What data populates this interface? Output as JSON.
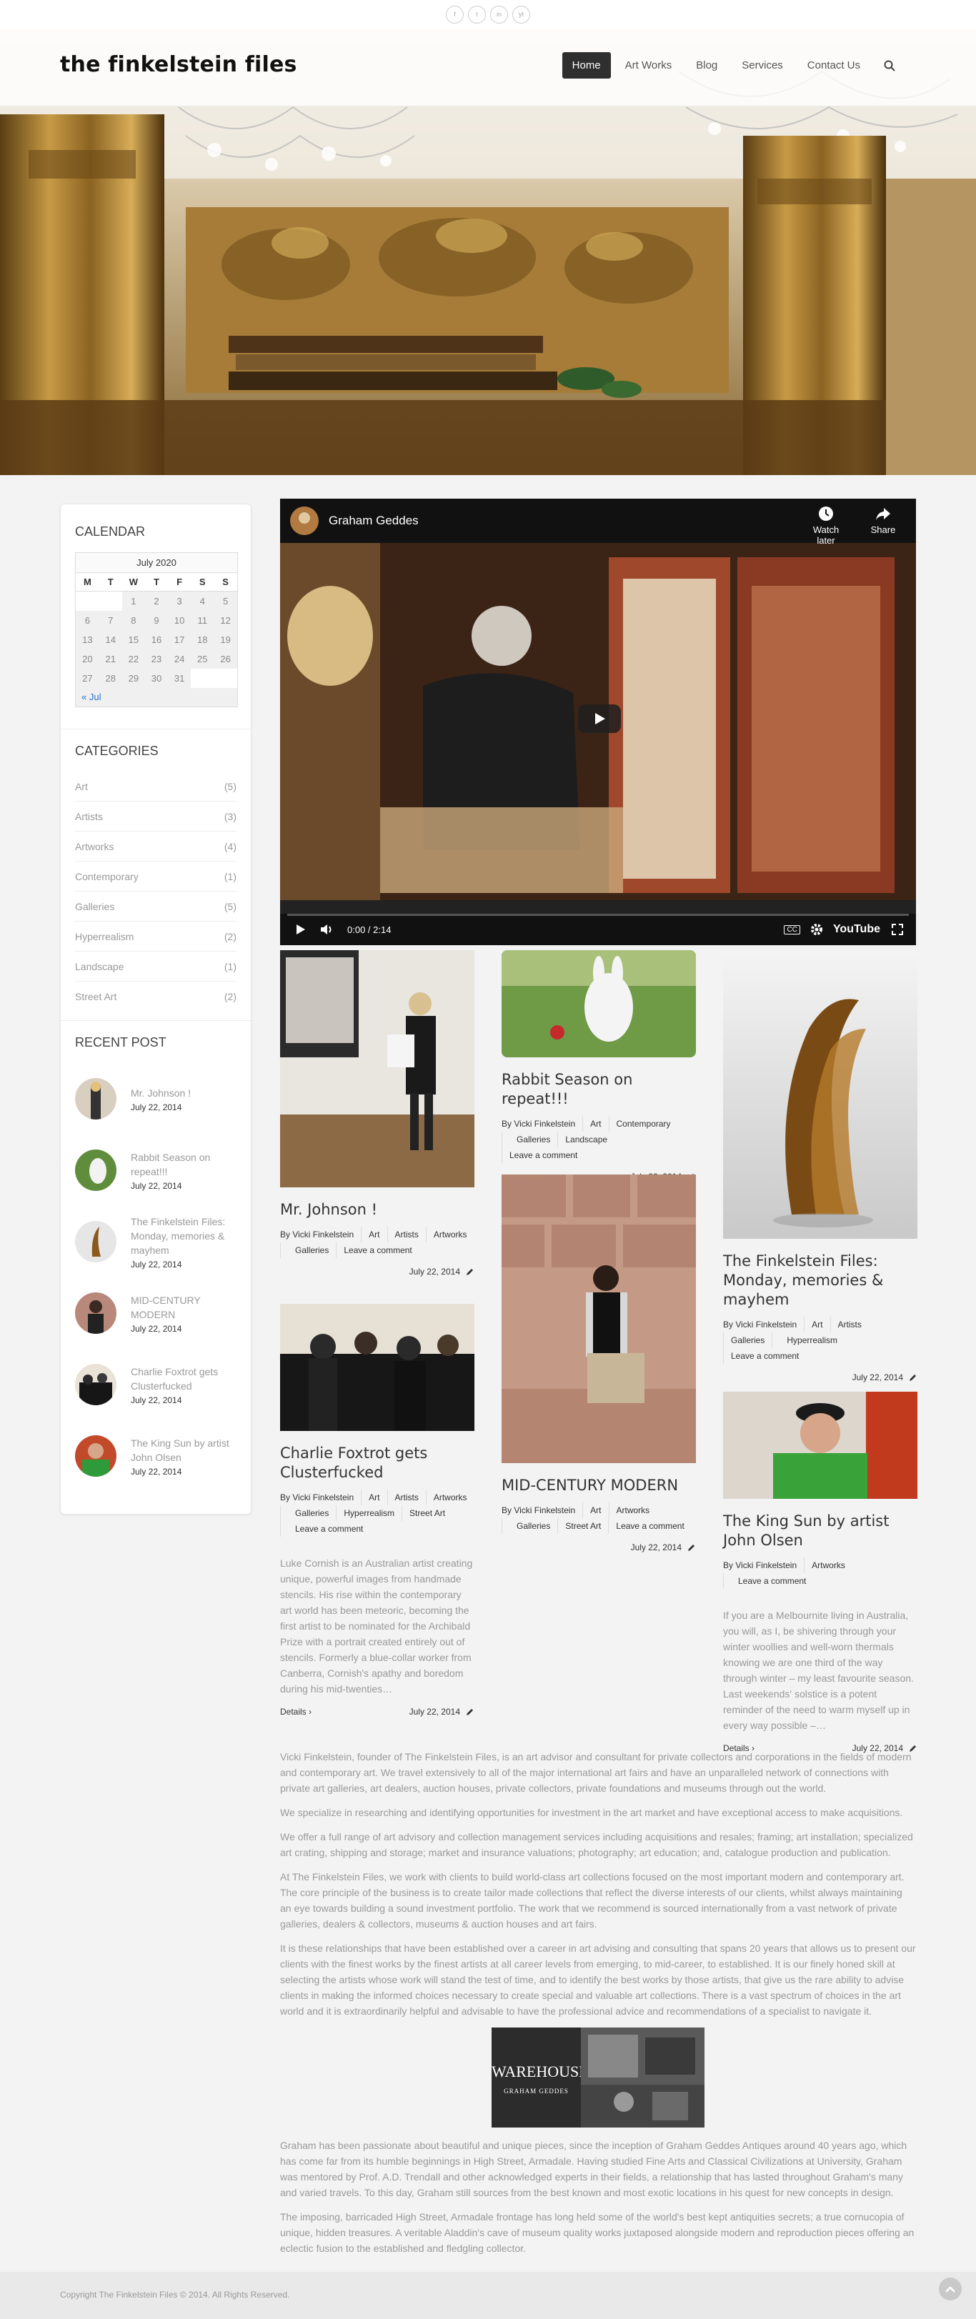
{
  "social": [
    "f",
    "t",
    "in",
    "yt"
  ],
  "site": {
    "logo": "the finkelstein files"
  },
  "nav": {
    "items": [
      "Home",
      "Art Works",
      "Blog",
      "Services",
      "Contact Us"
    ],
    "active": "Home"
  },
  "calendar": {
    "title": "CALENDAR",
    "month": "July 2020",
    "days": [
      "M",
      "T",
      "W",
      "T",
      "F",
      "S",
      "S"
    ],
    "weeks": [
      [
        "",
        "",
        "1",
        "2",
        "3",
        "4",
        "5"
      ],
      [
        "6",
        "7",
        "8",
        "9",
        "10",
        "11",
        "12"
      ],
      [
        "13",
        "14",
        "15",
        "16",
        "17",
        "18",
        "19"
      ],
      [
        "20",
        "21",
        "22",
        "23",
        "24",
        "25",
        "26"
      ],
      [
        "27",
        "28",
        "29",
        "30",
        "31",
        "",
        ""
      ]
    ],
    "prev": "« Jul"
  },
  "categories": {
    "title": "CATEGORIES",
    "items": [
      {
        "name": "Art",
        "count": "(5)"
      },
      {
        "name": "Artists",
        "count": "(3)"
      },
      {
        "name": "Artworks",
        "count": "(4)"
      },
      {
        "name": "Contemporary",
        "count": "(1)"
      },
      {
        "name": "Galleries",
        "count": "(5)"
      },
      {
        "name": "Hyperrealism",
        "count": "(2)"
      },
      {
        "name": "Landscape",
        "count": "(1)"
      },
      {
        "name": "Street Art",
        "count": "(2)"
      }
    ]
  },
  "recent": {
    "title": "RECENT POST",
    "items": [
      {
        "title": "Mr. Johnson !",
        "date": "July 22, 2014"
      },
      {
        "title": "Rabbit Season on repeat!!!",
        "date": "July 22, 2014"
      },
      {
        "title": "The Finkelstein Files: Monday, memories & mayhem",
        "date": "July 22, 2014"
      },
      {
        "title": "MID-CENTURY MODERN",
        "date": "July 22, 2014"
      },
      {
        "title": "Charlie Foxtrot gets Clusterfucked",
        "date": "July 22, 2014"
      },
      {
        "title": "The King Sun by artist John Olsen",
        "date": "July 22, 2014"
      }
    ]
  },
  "video": {
    "channel": "Graham Geddes",
    "watch_later": "Watch later",
    "share": "Share",
    "time": "0:00 / 2:14",
    "cc": "CC",
    "brand": "YouTube"
  },
  "posts": [
    {
      "title": "Mr. Johnson !",
      "by": "By Vicki Finkelstein",
      "tags": [
        "Art",
        "Artists",
        "Artworks",
        "Galleries"
      ],
      "comment": "Leave a comment",
      "date": "July 22, 2014"
    },
    {
      "title": "Rabbit Season on repeat!!!",
      "by": "By Vicki Finkelstein",
      "tags": [
        "Art",
        "Contemporary",
        "Galleries",
        "Landscape"
      ],
      "comment": "Leave a comment",
      "date": "July 22, 2014"
    },
    {
      "title": "The Finkelstein Files: Monday, memories & mayhem",
      "by": "By Vicki Finkelstein",
      "tags": [
        "Art",
        "Artists",
        "Galleries",
        "Hyperrealism"
      ],
      "comment": "Leave a comment",
      "date": "July 22, 2014"
    },
    {
      "title": "Charlie Foxtrot gets Clusterfucked",
      "by": "By Vicki Finkelstein",
      "tags": [
        "Art",
        "Artists",
        "Artworks",
        "Galleries",
        "Hyperrealism",
        "Street Art"
      ],
      "comment": "Leave a comment",
      "date": "July 22, 2014",
      "excerpt": "Luke Cornish is an Australian artist creating unique, powerful images from handmade stencils. His rise within the contemporary art world has been meteoric, becoming the first artist to be nominated for the Archibald Prize with a portrait created entirely out of stencils. Formerly a blue-collar worker from Canberra, Cornish's apathy and boredom during his mid-twenties…",
      "more": "Details"
    },
    {
      "title": "MID-CENTURY MODERN",
      "by": "By Vicki Finkelstein",
      "tags": [
        "Art",
        "Artworks",
        "Galleries",
        "Street Art"
      ],
      "comment": "Leave a comment",
      "date": "July 22, 2014"
    },
    {
      "title": "The King Sun by artist John Olsen",
      "by": "By Vicki Finkelstein",
      "tags": [
        "Artworks"
      ],
      "comment": "Leave a comment",
      "date": "July 22, 2014",
      "excerpt": "If you are a Melbournite living in Australia, you will, as I, be shivering through your winter woollies and well-worn thermals knowing we are one third of the way through winter – my least favourite season. Last weekends' solstice is a potent reminder of the need to warm myself up in every way possible –…",
      "more": "Details"
    }
  ],
  "about": {
    "p1": "Vicki Finkelstein, founder of The Finkelstein Files, is an art advisor and consultant for private collectors and corporations in the fields of modern and contemporary art. We travel extensively to all of the major international art fairs and have an unparalleled network of connections with private art galleries, art dealers, auction houses, private collectors, private foundations and museums through out the world.",
    "p2": "We specialize in researching and identifying opportunities for investment in the art market and have exceptional access to make acquisitions.",
    "p3": "We offer a full range of art advisory and collection management services including acquisitions and resales; framing; art installation; specialized art crating, shipping and storage; market and insurance valuations; photography; art education; and, catalogue production and publication.",
    "p4": "At The Finkelstein Files, we work with clients to build world-class art collections focused on the most important modern and contemporary art. The core principle of the business is to create tailor made collections that reflect the diverse interests of our clients, whilst always maintaining an eye towards building a sound investment portfolio. The work that we recommend is sourced internationally from a vast network of private galleries, dealers & collectors, museums & auction houses and art fairs.",
    "p5": "It is these relationships that have been established over a career in art advising and consulting that spans 20 years that allows us to present our clients with the finest works by the finest artists at all career levels from emerging, to mid-career, to established. It is our finely honed skill at selecting the artists whose work will stand the test of time, and to identify the best works by those artists, that give us the rare ability to advise clients in making the informed choices necessary to create special and valuable art collections. There is a vast spectrum of choices in the art world and it is extraordinarily helpful and advisable to have the professional advice and recommendations of a specialist to navigate it.",
    "warehouse_title": "WAREHOUSE",
    "warehouse_sub": "GRAHAM GEDDES",
    "p6": "Graham has been passionate about beautiful and unique pieces, since the inception of Graham Geddes Antiques around 40 years ago, which has come far from its humble beginnings in High Street, Armadale. Having studied Fine Arts and Classical Civilizations at University, Graham was mentored by Prof. A.D. Trendall and other acknowledged experts in their fields, a relationship that has lasted throughout Graham's many and varied travels. To this day, Graham still sources from the best known and most exotic locations in his quest for new concepts in design.",
    "p7": "The imposing, barricaded High Street, Armadale frontage has long held some of the world's best kept antiquities secrets; a true cornucopia of unique, hidden treasures. A veritable Aladdin's cave of museum quality works juxtaposed alongside modern and reproduction pieces offering an eclectic fusion to the established and fledgling collector."
  },
  "footer": {
    "copyright": "Copyright The Finkelstein Files © 2014. All Rights Reserved."
  }
}
